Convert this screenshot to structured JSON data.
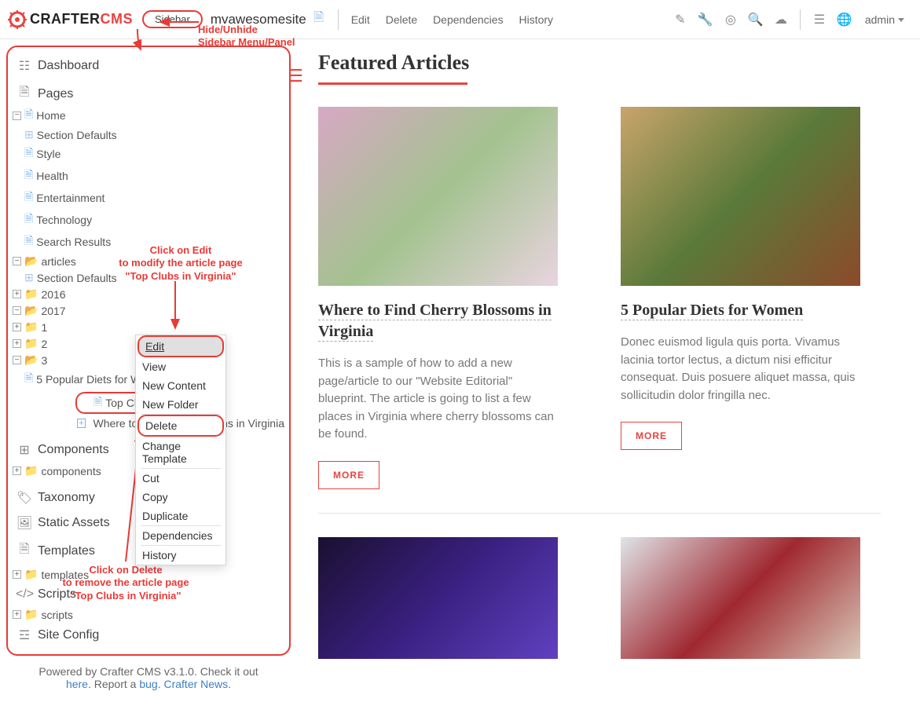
{
  "topbar": {
    "brand_black": "CRAFTER",
    "brand_red": "CMS",
    "sidebar_btn": "Sidebar",
    "site_name": "mvawesomesite",
    "links": {
      "edit": "Edit",
      "delete": "Delete",
      "deps": "Dependencies",
      "history": "History"
    },
    "user": "admin"
  },
  "annotations": {
    "hide": "Hide/Unhide\nSidebar Menu/Panel",
    "edit_note": "Click on Edit\nto modify the article page\n\"Top Clubs in Virginia\"",
    "delete_note": "Click on Delete\nto remove the article page\n\"Top Clubs in Virginia\""
  },
  "sidebar": {
    "dashboard": "Dashboard",
    "pages": "Pages",
    "home": "Home",
    "section_defaults": "Section Defaults",
    "style": "Style",
    "health": "Health",
    "entertainment": "Entertainment",
    "technology": "Technology",
    "search_results": "Search Results",
    "articles": "articles",
    "y2016": "2016",
    "y2017": "2017",
    "m1": "1",
    "m2": "2",
    "m3": "3",
    "a1": "5 Popular Diets for Women",
    "a2": "Top Clubs In Virginia",
    "a2_short": "Top Club",
    "a3": "Where to",
    "a3_rest": "ns in Virginia",
    "components": "Components",
    "components_sub": "components",
    "taxonomy": "Taxonomy",
    "static_assets": "Static Assets",
    "templates": "Templates",
    "templates_sub": "templates",
    "scripts": "Scripts",
    "scripts_sub": "scripts",
    "site_config": "Site Config"
  },
  "context": {
    "edit": "Edit",
    "view": "View",
    "new_content": "New Content",
    "new_folder": "New Folder",
    "delete": "Delete",
    "change_template": "Change Template",
    "cut": "Cut",
    "copy": "Copy",
    "duplicate": "Duplicate",
    "dependencies": "Dependencies",
    "history": "History"
  },
  "footer": {
    "t1": "Powered by Crafter CMS v3.1.0. Check it out ",
    "here": "here",
    "t2": ". Report a ",
    "bug": "bug",
    "t3": ". ",
    "news": "Crafter News",
    "t4": "."
  },
  "content": {
    "heading": "Featured Articles",
    "more": "MORE",
    "card1": {
      "title": "Where to Find Cherry Blossoms in Virginia",
      "body": "This is a sample of how to add a new page/article to our \"Website Editorial\" blueprint. The article is going to list a few places in Virginia where cherry blossoms can be found."
    },
    "card2": {
      "title": "5 Popular Diets for Women",
      "body": "Donec euismod ligula quis porta. Vivamus lacinia tortor lectus, a dictum nisi efficitur consequat. Duis posuere aliquet massa, quis sollicitudin dolor fringilla nec."
    }
  }
}
